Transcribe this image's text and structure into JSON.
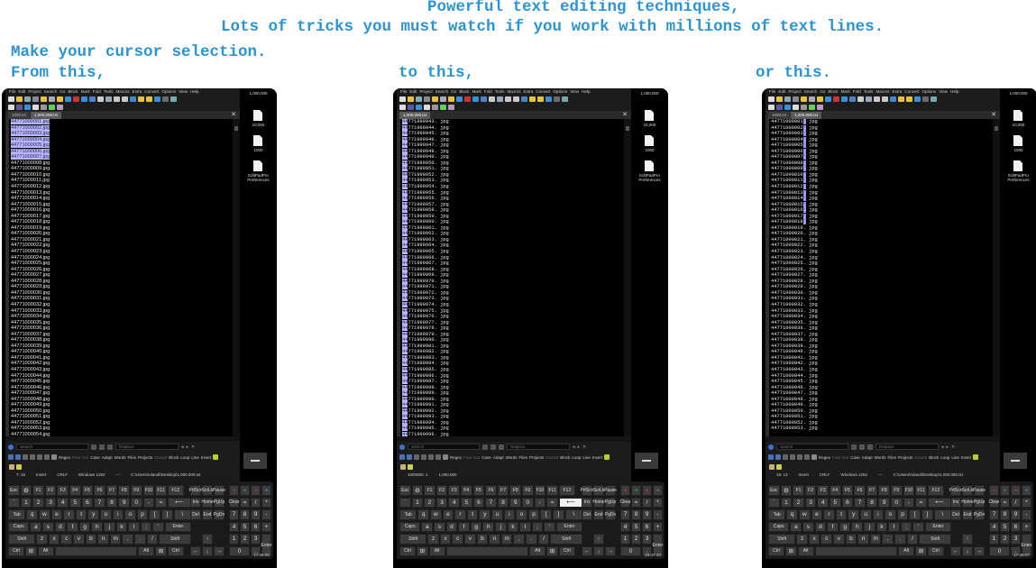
{
  "captions": {
    "line1": "Powerful text editing techniques,",
    "line2": "Lots of tricks you must watch if you work with millions of text lines.",
    "line3": "Make your cursor selection.",
    "from": "From this,",
    "to": "to this,",
    "or": "or this."
  },
  "app": {
    "menu": [
      "File",
      "Edit",
      "Project",
      "Search",
      "Go",
      "Block",
      "Mark",
      "Fold",
      "Tools",
      "Macros",
      "Extra",
      "Convert",
      "Options",
      "View",
      "Help"
    ],
    "search_placeholder": "Search",
    "replace_placeholder": "Replace",
    "options": [
      {
        "label": "Regex",
        "dim": false
      },
      {
        "label": "Free",
        "dim": true
      },
      {
        "label": "Dot",
        "dim": true
      },
      {
        "label": "Case",
        "dim": false
      },
      {
        "label": "Adapt",
        "dim": false
      },
      {
        "label": "Words",
        "dim": false
      },
      {
        "label": "Files",
        "dim": false
      },
      {
        "label": "Projects",
        "dim": false
      },
      {
        "label": "Closed",
        "dim": true
      },
      {
        "label": "Block",
        "dim": false
      },
      {
        "label": "Loop",
        "dim": false
      },
      {
        "label": "Line",
        "dim": false
      },
      {
        "label": "Invert",
        "dim": false
      }
    ]
  },
  "desktop": {
    "top_label": "1,000,000",
    "icons": [
      {
        "label": "10,000",
        "icon": "text-file-icon"
      },
      {
        "label": "1000",
        "icon": "text-file-icon"
      },
      {
        "label": "EditPadPro Preferences",
        "icon": "preferences-file-icon"
      }
    ]
  },
  "keyboard": {
    "rows": [
      [
        "Esc",
        "⚙",
        "F1",
        "F2",
        "F3",
        "F4",
        "F5",
        "F6",
        "F7",
        "F8",
        "F9",
        "F10",
        "F11",
        "F12"
      ],
      [
        "`",
        "1",
        "2",
        "3",
        "4",
        "5",
        "6",
        "7",
        "8",
        "9",
        "0",
        "-",
        "=",
        "⟵"
      ],
      [
        "Tab",
        "q",
        "w",
        "e",
        "r",
        "t",
        "y",
        "u",
        "i",
        "o",
        "p",
        "[",
        "]",
        "\\"
      ],
      [
        "Caps",
        "a",
        "s",
        "d",
        "f",
        "g",
        "h",
        "j",
        "k",
        "l",
        ";",
        "'",
        "Enter"
      ],
      [
        "Shift",
        "z",
        "x",
        "c",
        "v",
        "b",
        "n",
        "m",
        ",",
        ".",
        "/",
        "Shift"
      ],
      [
        "Ctrl",
        "⊞",
        "Alt",
        "",
        "Alt",
        "⊞",
        "Ctrl"
      ]
    ],
    "nav": [
      [
        "PrtScn",
        "ScrLk",
        "Pause"
      ],
      [
        "Ins",
        "Home",
        "PgUp"
      ],
      [
        "Del",
        "End",
        "PgDn"
      ]
    ],
    "arrows": [
      "↑",
      "←",
      "↓",
      "→"
    ],
    "numpad": [
      [
        "Clear",
        "=",
        "/",
        "*"
      ],
      [
        "7",
        "8",
        "9",
        "-"
      ],
      [
        "4",
        "5",
        "6",
        "+"
      ],
      [
        "1",
        "2",
        "3",
        "Enter"
      ],
      [
        "0",
        ".",
        ""
      ]
    ]
  },
  "panels": [
    {
      "caption_key": "from",
      "tabs": [
        {
          "label": "1000.txt",
          "active": false
        },
        {
          "label": "1,000,000.txt",
          "active": true
        }
      ],
      "lines": {
        "prefix": "44771",
        "start": 1,
        "count": 54,
        "pad": 6,
        "suffix": ".jpg",
        "mono": false
      },
      "selection": {
        "type": "lines",
        "from_line": 1,
        "to_line": 7
      },
      "current_line": 7,
      "status": {
        "position": "7: 15",
        "mode": "Insert",
        "line_end": "CRLF",
        "encoding": "Windows 1252",
        "extra": "---",
        "path": "C:\\Users\\rolandi\\Desktop\\1.000.000.txt"
      },
      "clock": "17:45:50",
      "pressed_key": null
    },
    {
      "caption_key": "to",
      "tabs": [
        {
          "label": "1,000,000.txt",
          "active": true
        }
      ],
      "lines": {
        "prefix": "44771",
        "start": 999943,
        "count": 58,
        "pad": 6,
        "suffix": ". jpg",
        "mono": true
      },
      "selection": {
        "type": "column",
        "chars": 2,
        "from_line": 999943,
        "to_line": 1000000
      },
      "current_line": 1000000,
      "status": {
        "position": "1000000: 1",
        "mode": "1,000,000",
        "line_end": "",
        "encoding": "",
        "extra": "",
        "path": ""
      },
      "clock": "18:47:33",
      "pressed_key": "⟵"
    },
    {
      "caption_key": "or",
      "tabs": [
        {
          "label": "1000.txt",
          "active": false
        },
        {
          "label": "1,000,000.txt",
          "active": true
        }
      ],
      "lines": {
        "prefix": "44771",
        "start": 1,
        "count": 53,
        "pad": 6,
        "suffix": ". jpg",
        "mono": true
      },
      "selection": {
        "type": "caret-column",
        "column": 12,
        "from_line": 1,
        "to_line": 18
      },
      "current_line": 18,
      "status": {
        "position": "18: 13",
        "mode": "Insert",
        "line_end": "CRLF",
        "encoding": "Windows 1252",
        "extra": "---",
        "path": "C:\\Users\\rolandi\\Desktop\\1.000.000.txt"
      },
      "clock": "17:46:07",
      "pressed_key": null
    }
  ]
}
